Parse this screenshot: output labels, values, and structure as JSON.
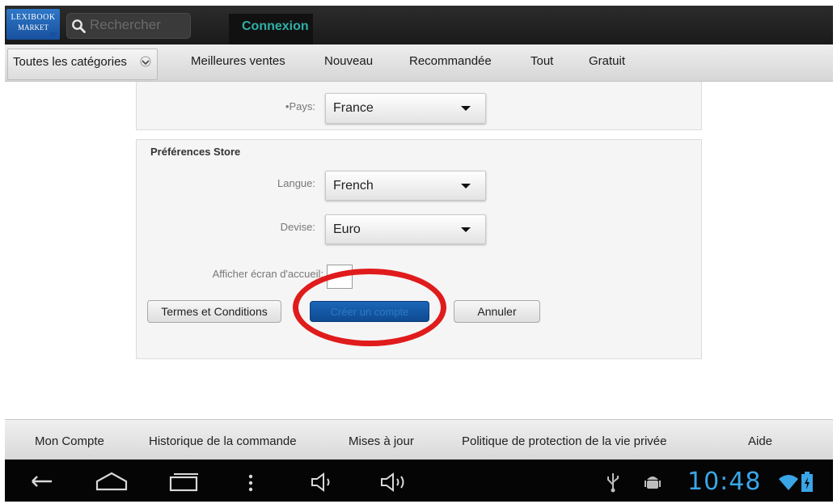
{
  "topbar": {
    "logo_line1": "LEXIBOOK",
    "logo_line2": "MARKET",
    "search_placeholder": "Rechercher",
    "login_tab": "Connexion"
  },
  "categories": {
    "dropdown": "Toutes les catégories",
    "tabs": [
      "Meilleures ventes",
      "Nouveau",
      "Recommandée",
      "Tout",
      "Gratuit"
    ]
  },
  "form": {
    "country_label": "•Pays:",
    "country_value": "France",
    "prefs_heading": "Préférences Store",
    "language_label": "Langue:",
    "language_value": "French",
    "currency_label": "Devise:",
    "currency_value": "Euro",
    "homescreen_label": "Afficher écran d'accueil:",
    "homescreen_checked": false
  },
  "buttons": {
    "terms": "Termes et Conditions",
    "create_account": "Créer un compte",
    "cancel": "Annuler"
  },
  "footer": {
    "links": [
      "Mon Compte",
      "Historique de la commande",
      "Mises à jour",
      "Politique de protection de la vie privée",
      "Aide"
    ]
  },
  "system": {
    "clock": "10:48",
    "clock_color": "#3aa6e8"
  },
  "colors": {
    "login_accent": "#2fb0a6",
    "highlight": "#e01b1b",
    "primary_button": "#1b66b8"
  },
  "icons": [
    "search-icon",
    "chevron-down-icon",
    "back-icon",
    "home-icon",
    "recent-apps-icon",
    "menu-icon",
    "volume-down-icon",
    "volume-up-icon",
    "usb-icon",
    "android-debug-icon",
    "wifi-icon",
    "battery-icon"
  ]
}
